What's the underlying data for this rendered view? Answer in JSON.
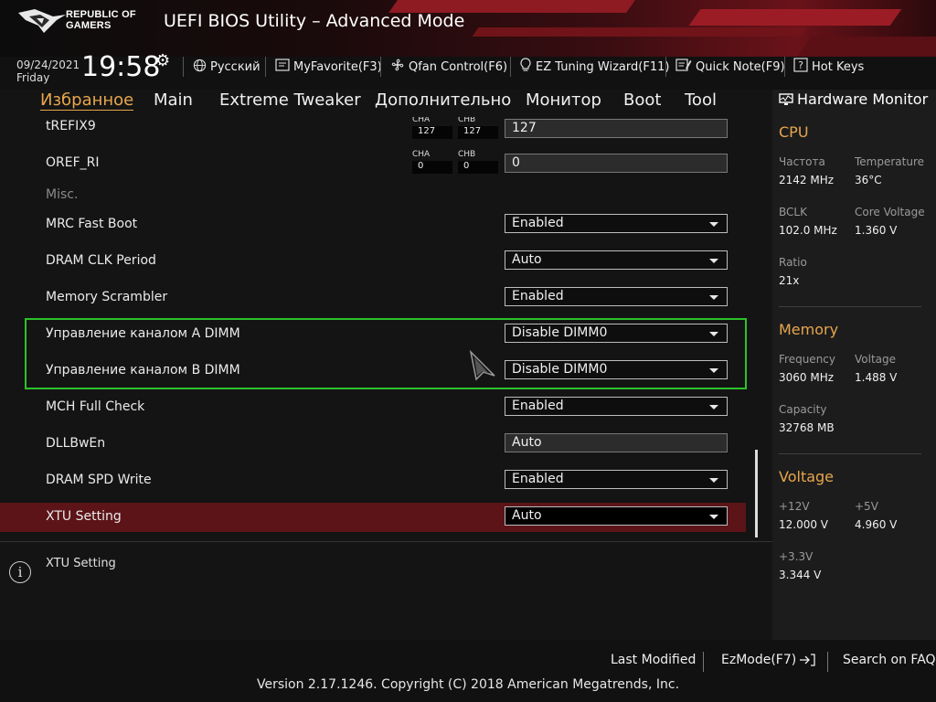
{
  "header": {
    "logo_line1": "REPUBLIC OF",
    "logo_line2": "GAMERS",
    "title": "UEFI BIOS Utility – Advanced Mode"
  },
  "toolbar": {
    "date": "09/24/2021",
    "day": "Friday",
    "time": "19:58",
    "language": "Русский",
    "myfavorite": "MyFavorite(F3)",
    "qfan": "Qfan Control(F6)",
    "ez_tuning": "EZ Tuning Wizard(F11)",
    "quick_note": "Quick Note(F9)",
    "hot_keys": "Hot Keys"
  },
  "nav": {
    "tabs": [
      {
        "label": "Избранное",
        "active": true
      },
      {
        "label": "Main"
      },
      {
        "label": "Extreme Tweaker"
      },
      {
        "label": "Дополнительно"
      },
      {
        "label": "Монитор"
      },
      {
        "label": "Boot"
      },
      {
        "label": "Tool"
      }
    ]
  },
  "settings": {
    "trefix9": {
      "label": "tREFIX9",
      "cha_label": "CHA",
      "chb_label": "CHB",
      "cha": "127",
      "chb": "127",
      "value": "127"
    },
    "oref_ri": {
      "label": "OREF_RI",
      "cha_label": "CHA",
      "chb_label": "CHB",
      "cha": "0",
      "chb": "0",
      "value": "0"
    },
    "misc": "Misc.",
    "mrc_fast_boot": {
      "label": "MRC Fast Boot",
      "value": "Enabled"
    },
    "dram_clk_period": {
      "label": "DRAM CLK Period",
      "value": "Auto"
    },
    "memory_scrambler": {
      "label": "Memory Scrambler",
      "value": "Enabled"
    },
    "dimm_a": {
      "label": "Управление каналом A DIMM",
      "value": "Disable DIMM0"
    },
    "dimm_b": {
      "label": "Управление каналом B DIMM",
      "value": "Disable DIMM0"
    },
    "mch_full_check": {
      "label": "MCH Full Check",
      "value": "Enabled"
    },
    "dllbwen": {
      "label": "DLLBwEn",
      "value": "Auto"
    },
    "dram_spd_write": {
      "label": "DRAM SPD Write",
      "value": "Enabled"
    },
    "xtu_setting": {
      "label": "XTU Setting",
      "value": "Auto"
    }
  },
  "help": {
    "text": "XTU Setting"
  },
  "hardware_monitor": {
    "title": "Hardware Monitor",
    "cpu": {
      "heading": "CPU",
      "freq_label": "Частота",
      "freq": "2142 MHz",
      "temp_label": "Temperature",
      "temp": "36°C",
      "bclk_label": "BCLK",
      "bclk": "102.0 MHz",
      "core_v_label": "Core Voltage",
      "core_v": "1.360 V",
      "ratio_label": "Ratio",
      "ratio": "21x"
    },
    "memory": {
      "heading": "Memory",
      "freq_label": "Frequency",
      "freq": "3060 MHz",
      "volt_label": "Voltage",
      "volt": "1.488 V",
      "cap_label": "Capacity",
      "cap": "32768 MB"
    },
    "voltage": {
      "heading": "Voltage",
      "v12_label": "+12V",
      "v12": "12.000 V",
      "v5_label": "+5V",
      "v5": "4.960 V",
      "v33_label": "+3.3V",
      "v33": "3.344 V"
    }
  },
  "footer": {
    "last_modified": "Last Modified",
    "ezmode": "EzMode(F7)",
    "search_faq": "Search on FAQ",
    "copyright": "Version 2.17.1246. Copyright (C) 2018 American Megatrends, Inc."
  },
  "colors": {
    "accent": "#e8a64c",
    "highlight_row": "#5c1418",
    "group_border": "#2bc22b"
  }
}
